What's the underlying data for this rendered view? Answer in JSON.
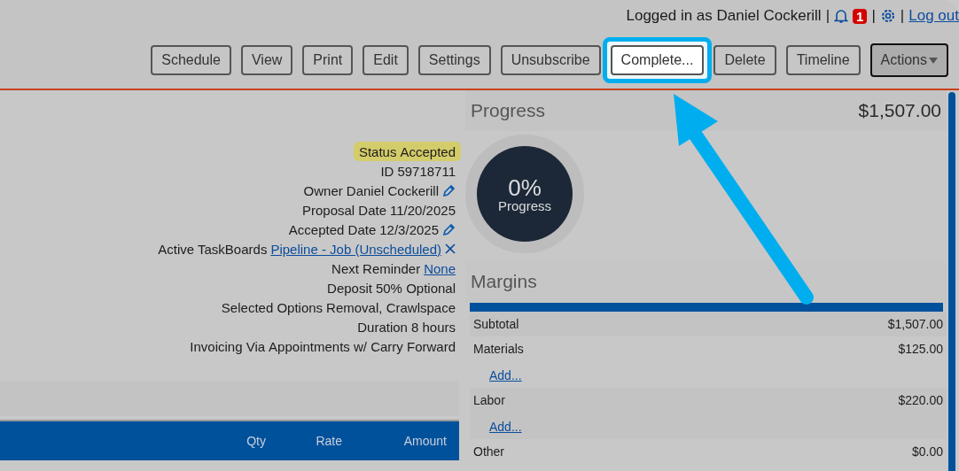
{
  "header": {
    "login_text": "Logged in as Daniel Cockerill",
    "separator_1": "|",
    "notification_count": "1",
    "separator_2": "|",
    "separator_3": "|",
    "logout_link": "Log out"
  },
  "toolbar": [
    {
      "label": "Schedule",
      "kind": "button",
      "highlighted": false
    },
    {
      "label": "View",
      "kind": "button",
      "highlighted": false
    },
    {
      "label": "Print",
      "kind": "button",
      "highlighted": false
    },
    {
      "label": "Edit",
      "kind": "button",
      "highlighted": false
    },
    {
      "label": "Settings",
      "kind": "button",
      "highlighted": false
    },
    {
      "label": "Unsubscribe",
      "kind": "button",
      "highlighted": false
    },
    {
      "label": "Complete...",
      "kind": "button",
      "highlighted": true
    },
    {
      "label": "Delete",
      "kind": "button",
      "highlighted": false
    },
    {
      "label": "Timeline",
      "kind": "button",
      "highlighted": false
    },
    {
      "label": "Actions",
      "kind": "dropdown",
      "highlighted": false
    }
  ],
  "details": [
    {
      "label": "Status",
      "value": "Accepted",
      "kind": "text",
      "highlighted": true,
      "editable": false,
      "removable": false
    },
    {
      "label": "ID",
      "value": "59718711",
      "kind": "text",
      "highlighted": false,
      "editable": false,
      "removable": false
    },
    {
      "label": "Owner",
      "value": "Daniel Cockerill",
      "kind": "text",
      "highlighted": false,
      "editable": true,
      "removable": false
    },
    {
      "label": "Proposal Date",
      "value": "11/20/2025",
      "kind": "text",
      "highlighted": false,
      "editable": false,
      "removable": false
    },
    {
      "label": "Accepted Date",
      "value": "12/3/2025",
      "kind": "text",
      "highlighted": false,
      "editable": true,
      "removable": false
    },
    {
      "label": "Active TaskBoards",
      "value": "Pipeline - Job (Unscheduled)",
      "kind": "link",
      "highlighted": false,
      "editable": false,
      "removable": true
    },
    {
      "label": "Next Reminder",
      "value": "None",
      "kind": "link",
      "highlighted": false,
      "editable": false,
      "removable": false
    },
    {
      "label": "Deposit",
      "value": "50% Optional",
      "kind": "text",
      "highlighted": false,
      "editable": false,
      "removable": false
    },
    {
      "label": "Selected Options",
      "value": "Removal, Crawlspace",
      "kind": "text",
      "highlighted": false,
      "editable": false,
      "removable": false
    },
    {
      "label": "Duration",
      "value": "8 hours",
      "kind": "text",
      "highlighted": false,
      "editable": false,
      "removable": false
    },
    {
      "label": "Invoicing Via",
      "value": "Appointments w/ Carry Forward",
      "kind": "text",
      "highlighted": false,
      "editable": false,
      "removable": false
    }
  ],
  "table": {
    "columns": [
      "Qty",
      "Rate",
      "Amount"
    ]
  },
  "progress": {
    "title": "Progress",
    "total": "$1,507.00",
    "percent": "0%",
    "caption": "Progress"
  },
  "margins": {
    "title": "Margins",
    "rows": [
      {
        "label": "Subtotal",
        "value": "$1,507.00"
      },
      {
        "label": "Materials",
        "value": "$125.00",
        "add_link": "Add..."
      },
      {
        "label": "Labor",
        "value": "$220.00",
        "add_link": "Add..."
      },
      {
        "label": "Other",
        "value": "$0.00"
      }
    ]
  }
}
